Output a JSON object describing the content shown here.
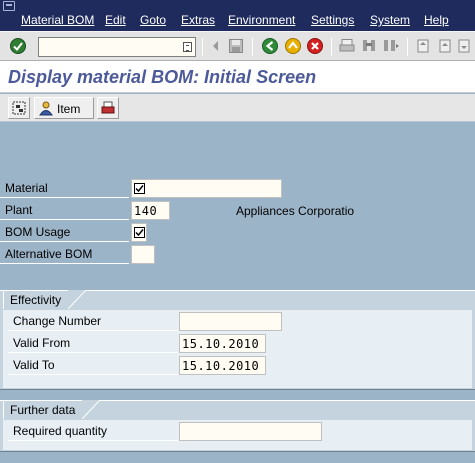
{
  "menu": {
    "items": [
      "Material BOM",
      "Edit",
      "Goto",
      "Extras",
      "Environment",
      "Settings",
      "System",
      "Help"
    ]
  },
  "toolbar": {
    "command_value": ""
  },
  "page": {
    "title": "Display material BOM: Initial Screen"
  },
  "app_toolbar": {
    "item_label": "Item"
  },
  "form": {
    "material": {
      "label": "Material",
      "value": ""
    },
    "plant": {
      "label": "Plant",
      "value": "140",
      "description": "Appliances Corporatio"
    },
    "bom_usage": {
      "label": "BOM Usage",
      "value": ""
    },
    "alternative_bom": {
      "label": "Alternative BOM",
      "value": ""
    }
  },
  "effectivity": {
    "title": "Effectivity",
    "change_number": {
      "label": "Change Number",
      "value": ""
    },
    "valid_from": {
      "label": "Valid From",
      "value": "15.10.2010"
    },
    "valid_to": {
      "label": "Valid To",
      "value": "15.10.2010"
    }
  },
  "further_data": {
    "title": "Further data",
    "required_quantity": {
      "label": "Required quantity",
      "value": ""
    }
  },
  "colors": {
    "menubar": "#1f2b5d",
    "title_text": "#4d5a9a",
    "background": "#9cb4c8",
    "field_bg": "#fffdf3"
  }
}
